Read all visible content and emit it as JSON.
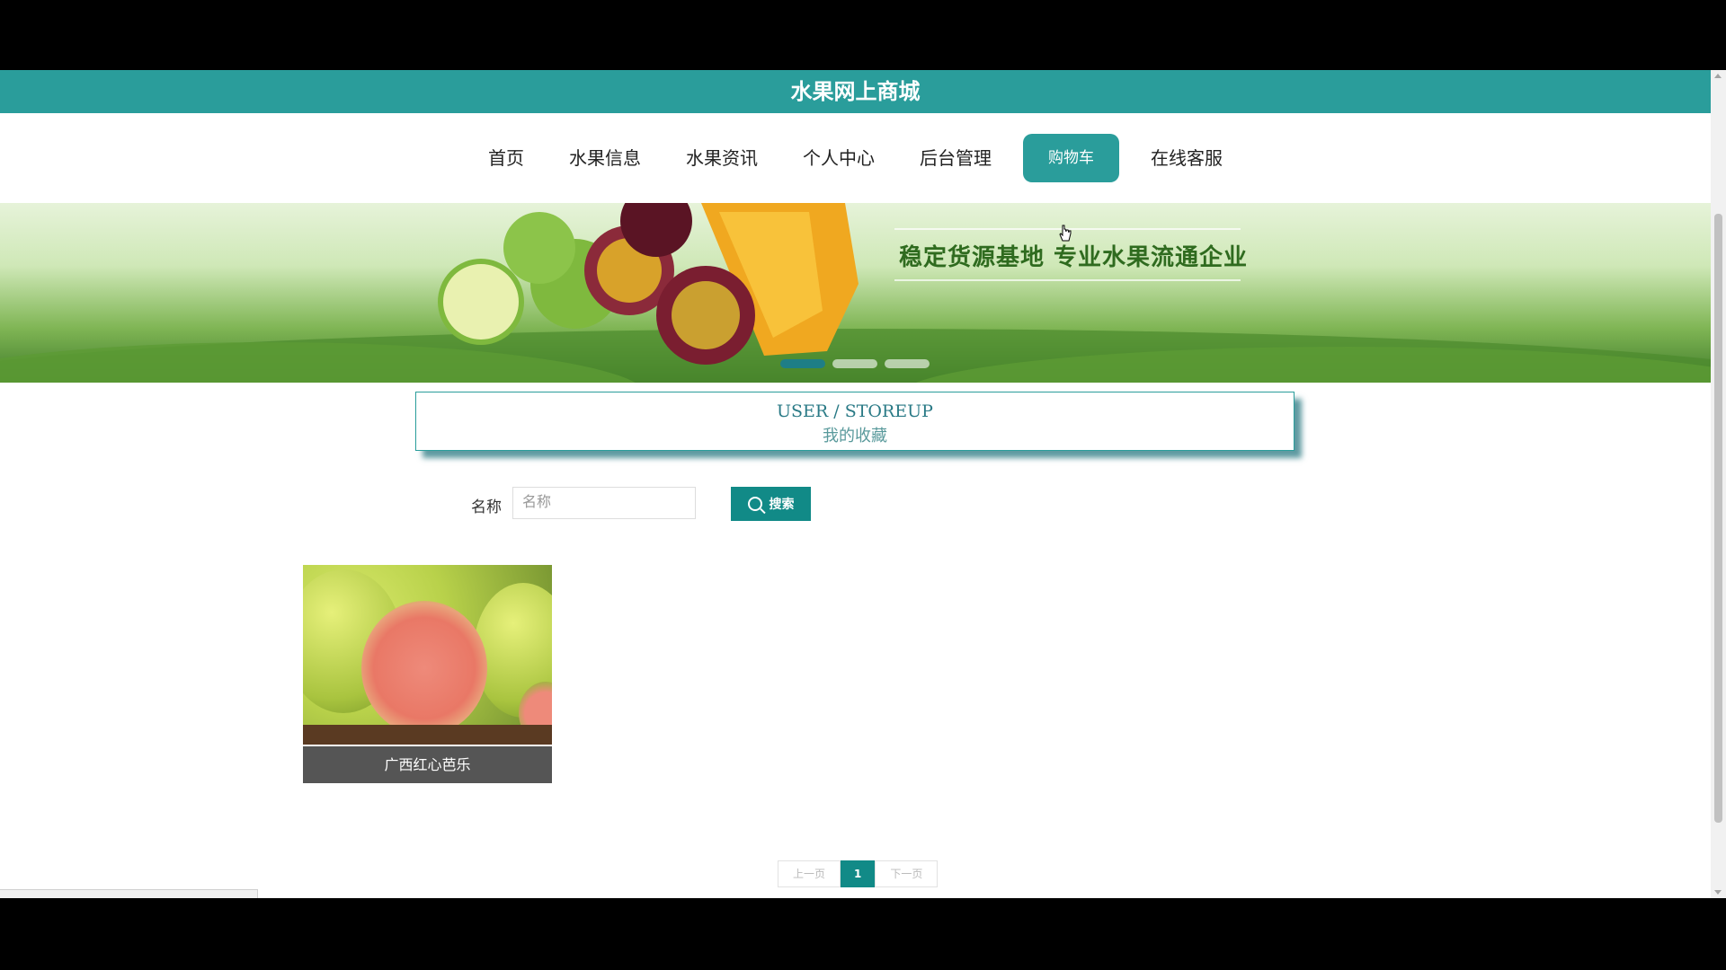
{
  "site": {
    "title": "水果网上商城"
  },
  "nav": {
    "items": [
      {
        "label": "首页"
      },
      {
        "label": "水果信息"
      },
      {
        "label": "水果资讯"
      },
      {
        "label": "个人中心"
      },
      {
        "label": "后台管理"
      },
      {
        "label": "购物车",
        "active": true
      },
      {
        "label": "在线客服"
      }
    ]
  },
  "banner": {
    "slogan": "稳定货源基地 专业水果流通企业",
    "carousel": {
      "slide_count": 3,
      "active_index": 0
    }
  },
  "section": {
    "title_en": "USER / STOREUP",
    "title_cn": "我的收藏"
  },
  "search": {
    "label": "名称",
    "placeholder": "名称",
    "value": "",
    "button_label": "搜索"
  },
  "favorites": [
    {
      "name": "广西红心芭乐"
    }
  ],
  "pagination": {
    "prev_label": "上一页",
    "current_page": "1",
    "next_label": "下一页"
  },
  "colors": {
    "primary": "#2a9d9b",
    "button": "#118a87"
  }
}
